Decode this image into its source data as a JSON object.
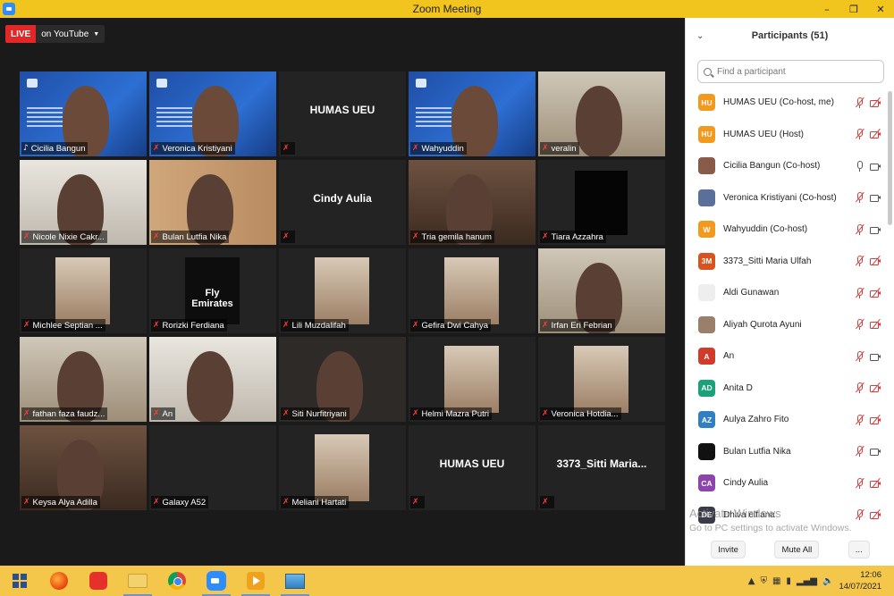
{
  "window": {
    "title": "Zoom Meeting",
    "controls": [
      "–",
      "❐",
      "✕"
    ]
  },
  "live": {
    "badge": "LIVE",
    "destination": "on YouTube"
  },
  "tiles": [
    {
      "name": "Cicilia Bangun",
      "kind": "video",
      "scene": "slide",
      "muted": false,
      "active": true
    },
    {
      "name": "Veronica Kristiyani",
      "kind": "video",
      "scene": "slide",
      "muted": true
    },
    {
      "name": "HUMAS UEU",
      "kind": "name",
      "muted": true
    },
    {
      "name": "Wahyuddin",
      "kind": "video",
      "scene": "slide",
      "muted": true
    },
    {
      "name": "veralin",
      "kind": "video",
      "scene": "room",
      "muted": true
    },
    {
      "name": "Nicole Nixie Cakr...",
      "kind": "video",
      "scene": "bright",
      "muted": true
    },
    {
      "name": "Bulan Lutfia Nika",
      "kind": "video",
      "scene": "wall",
      "muted": true
    },
    {
      "name": "Cindy Aulia",
      "kind": "name",
      "muted": true
    },
    {
      "name": "Tria gemila hanum",
      "kind": "video",
      "scene": "warm",
      "muted": true
    },
    {
      "name": "Tiara Azzahra",
      "kind": "video",
      "scene": "black",
      "muted": true
    },
    {
      "name": "Michlee Septian ...",
      "kind": "video",
      "scene": "inset",
      "muted": true
    },
    {
      "name": "Rorizki Ferdiana",
      "kind": "video",
      "scene": "logo",
      "muted": true,
      "overlay_text": "Fly Emirates"
    },
    {
      "name": "Lili Muzdalifah",
      "kind": "video",
      "scene": "inset",
      "muted": true
    },
    {
      "name": "Gefira Dwi Cahya",
      "kind": "video",
      "scene": "inset",
      "muted": true
    },
    {
      "name": "Irfan Eri Febrian",
      "kind": "video",
      "scene": "room",
      "muted": true
    },
    {
      "name": "fathan faza faudz...",
      "kind": "video",
      "scene": "room",
      "muted": true
    },
    {
      "name": "An",
      "kind": "video",
      "scene": "bright",
      "muted": true
    },
    {
      "name": "Siti Nurfitriyani",
      "kind": "video",
      "scene": "dark",
      "muted": true
    },
    {
      "name": "Helmi Mazra Putri",
      "kind": "video",
      "scene": "inset",
      "muted": true
    },
    {
      "name": "Veronica Hotdia...",
      "kind": "video",
      "scene": "inset",
      "muted": true
    },
    {
      "name": "Keysa Alya Adilla",
      "kind": "video",
      "scene": "warm",
      "muted": true
    },
    {
      "name": "Galaxy A52",
      "kind": "video",
      "scene": "blank",
      "muted": true
    },
    {
      "name": "Meliani Hartati",
      "kind": "video",
      "scene": "inset",
      "muted": true
    },
    {
      "name": "HUMAS UEU",
      "kind": "name",
      "muted": true
    },
    {
      "name": "3373_Sitti  Maria...",
      "kind": "name",
      "muted": true
    }
  ],
  "panel": {
    "title": "Participants (51)",
    "search_placeholder": "Find a participant",
    "participants": [
      {
        "initials": "HU",
        "name": "HUMAS UEU (Co-host, me)",
        "color": "#f39a1e",
        "mic": "muted",
        "cam": "off"
      },
      {
        "initials": "HU",
        "name": "HUMAS UEU (Host)",
        "color": "#f39a1e",
        "mic": "muted",
        "cam": "off"
      },
      {
        "initials": "",
        "name": "Cicilia Bangun (Co-host)",
        "color": "#8a5a4a",
        "mic": "on",
        "cam": "on"
      },
      {
        "initials": "",
        "name": "Veronica Kristiyani (Co-host)",
        "color": "#5a6f9a",
        "mic": "muted",
        "cam": "on"
      },
      {
        "initials": "W",
        "name": "Wahyuddin (Co-host)",
        "color": "#f39a1e",
        "mic": "muted",
        "cam": "on"
      },
      {
        "initials": "3M",
        "name": "3373_Sitti Maria Ulfah",
        "color": "#d9531e",
        "mic": "muted",
        "cam": "off"
      },
      {
        "initials": "",
        "name": "Aldi Gunawan",
        "color": "#eeeeee",
        "mic": "muted",
        "cam": "off"
      },
      {
        "initials": "",
        "name": "Aliyah Qurota Ayuni",
        "color": "#9a7f6a",
        "mic": "muted",
        "cam": "off"
      },
      {
        "initials": "A",
        "name": "An",
        "color": "#d13b2a",
        "mic": "muted",
        "cam": "on"
      },
      {
        "initials": "AD",
        "name": "Anita D",
        "color": "#1aa37a",
        "mic": "muted",
        "cam": "off"
      },
      {
        "initials": "AZ",
        "name": "Aulya Zahro Fito",
        "color": "#2f7fc2",
        "mic": "muted",
        "cam": "off"
      },
      {
        "initials": "",
        "name": "Bulan Lutfia Nika",
        "color": "#111111",
        "mic": "muted",
        "cam": "on"
      },
      {
        "initials": "CA",
        "name": "Cindy Aulia",
        "color": "#8e44ad",
        "mic": "muted",
        "cam": "off"
      },
      {
        "initials": "DE",
        "name": "Dhiva elfiana",
        "color": "#3a3a4a",
        "mic": "muted",
        "cam": "off"
      }
    ],
    "footer": {
      "invite": "Invite",
      "mute_all": "Mute All",
      "more": "..."
    }
  },
  "watermark": {
    "line1": "Activate Windows",
    "line2": "Go to PC settings to activate Windows."
  },
  "taskbar": {
    "time": "12:06",
    "date": "14/07/2021"
  }
}
